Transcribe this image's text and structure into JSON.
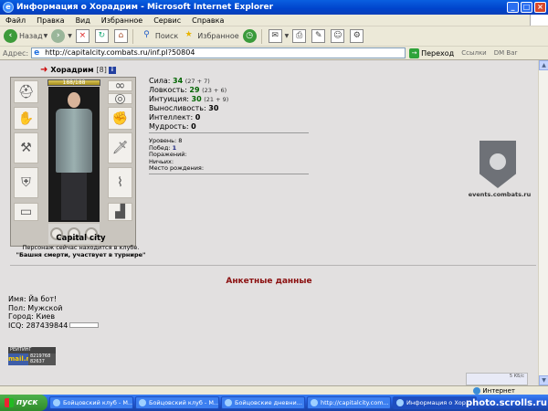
{
  "window": {
    "title": "Информация о Хорадрим - Microsoft Internet Explorer",
    "min_glyph": "_",
    "max_glyph": "□",
    "close_glyph": "×"
  },
  "menu": [
    "Файл",
    "Правка",
    "Вид",
    "Избранное",
    "Сервис",
    "Справка"
  ],
  "toolbar": {
    "back_label": "Назад",
    "search_label": "Поиск",
    "favorites_label": "Избранное"
  },
  "address": {
    "label": "Адрес:",
    "url": "http://capitalcity.combats.ru/inf.pl?50804",
    "go_label": "Переход",
    "links_label": "Ссылки",
    "dmbar_label": "DM Bar"
  },
  "character": {
    "name": "Хорадрим",
    "level": "[8]",
    "info_icon": "i",
    "hp_text": "188/188",
    "hp_fraction": 1.0,
    "city": "Capital city",
    "location_line1": "Персонаж сейчас находится в клубе.",
    "location_line2": "\"Башня смерти, участвует в турнире\""
  },
  "stats": [
    {
      "label": "Сила:",
      "value": "34",
      "bonus": "(27 + 7)",
      "colored": true
    },
    {
      "label": "Ловкость:",
      "value": "29",
      "bonus": "(23 + 6)",
      "colored": true
    },
    {
      "label": "Интуиция:",
      "value": "30",
      "bonus": "(21 + 9)",
      "colored": true
    },
    {
      "label": "Выносливость:",
      "value": "30",
      "bonus": "",
      "colored": false
    },
    {
      "label": "Интеллект:",
      "value": "0",
      "bonus": "",
      "colored": false
    },
    {
      "label": "Мудрость:",
      "value": "0",
      "bonus": "",
      "colored": false
    }
  ],
  "record": {
    "level_label": "Уровень:",
    "level_value": "8",
    "wins_label": "Побед:",
    "wins_value": "1",
    "losses_label": "Поражений:",
    "draws_label": "Ничьих:",
    "birthplace_label": "Место рождения:"
  },
  "emblem": {
    "caption": "events.combats.ru"
  },
  "anket": {
    "heading": "Анкетные данные",
    "name_line": "Имя: Йа бот!",
    "gender_line": "Пол: Мужской",
    "city_line": "Город: Киев",
    "icq_line": "ICQ: 287439844"
  },
  "counter": {
    "top": "РЕЙТИНГ 452353716",
    "brand": "mail.ru",
    "bottom1": "8219768",
    "bottom2": "82637"
  },
  "status": {
    "zone": "Интернет"
  },
  "tray": {
    "text": "5 КБ/с"
  },
  "taskbar": {
    "start_label": "пуск",
    "tasks": [
      {
        "label": "Бойцовский клуб - M...",
        "active": false
      },
      {
        "label": "Бойцовский клуб - M...",
        "active": false
      },
      {
        "label": "Бойцовские дневни...",
        "active": false
      },
      {
        "label": "http://capitalcity.com...",
        "active": false
      },
      {
        "label": "Информация о Хор...",
        "active": true
      }
    ]
  },
  "watermark": "photo.scrolls.ru"
}
